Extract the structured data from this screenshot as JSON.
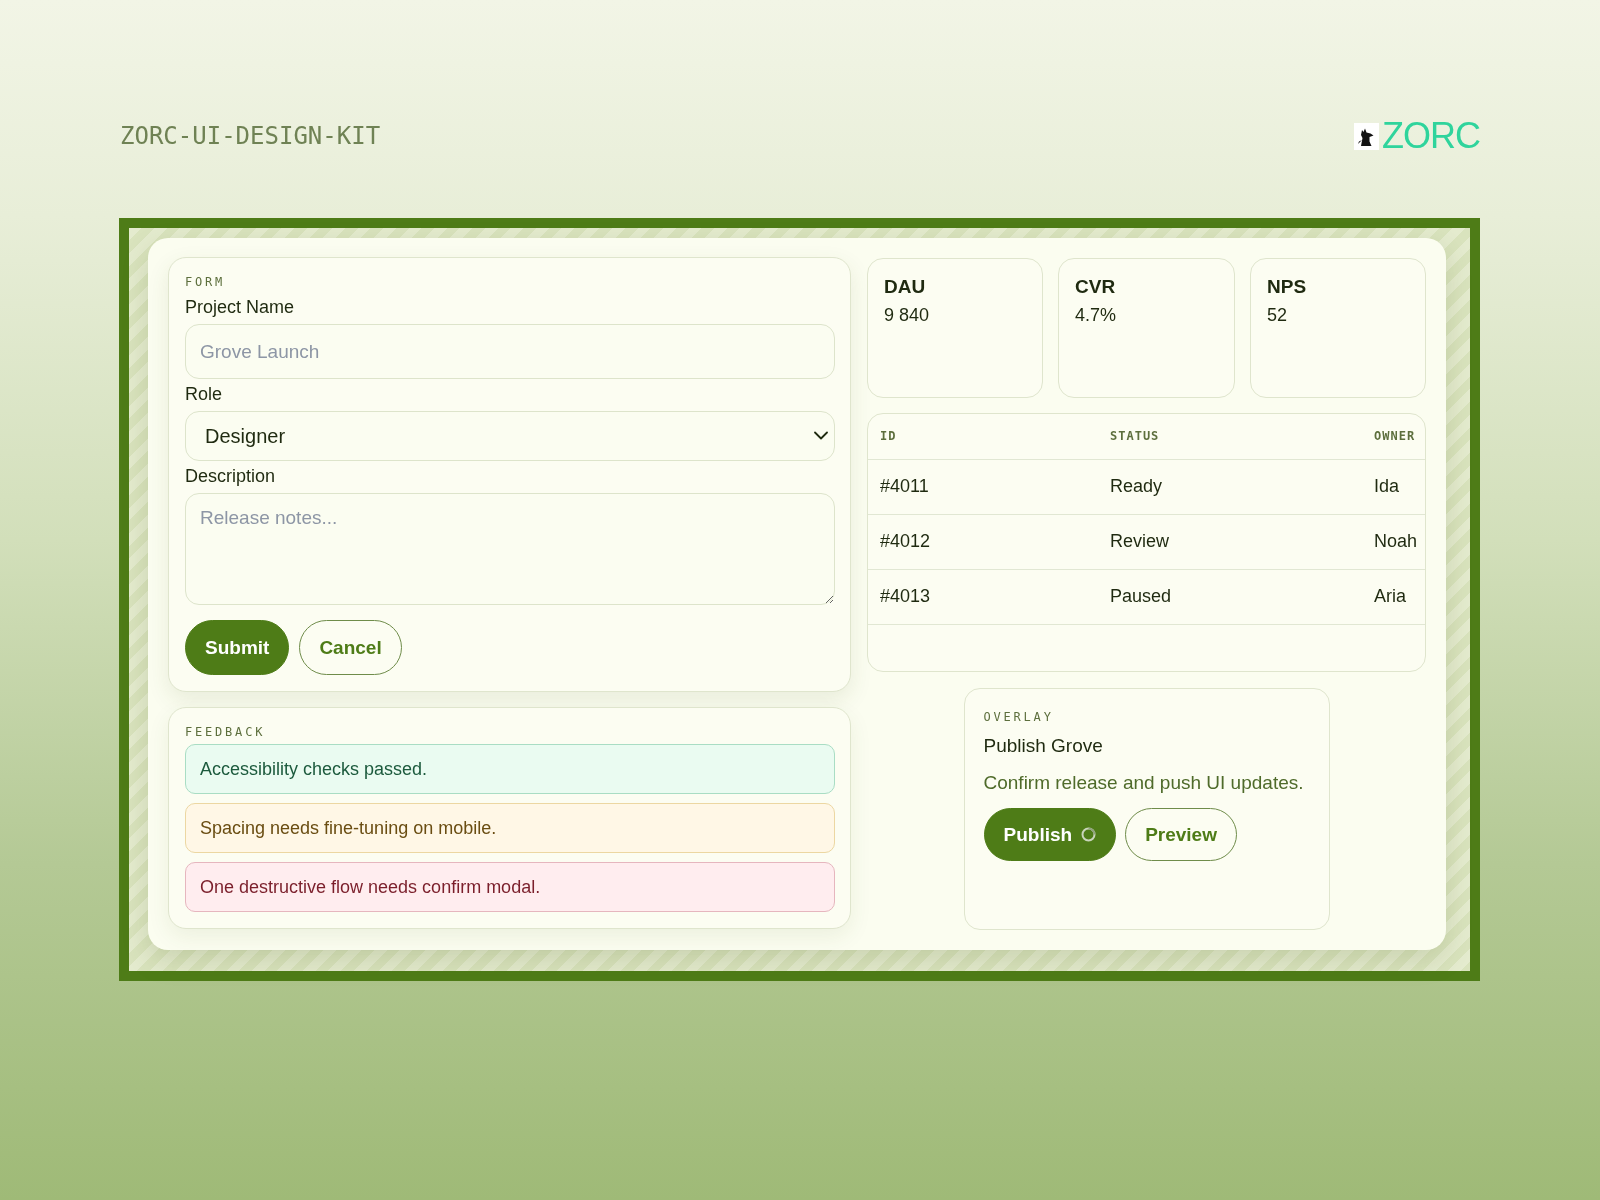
{
  "header": {
    "title": "ZORC-UI-DESIGN-KIT",
    "logo": "ZORC"
  },
  "form": {
    "section_label": "FORM",
    "fields": [
      {
        "kind": "text",
        "label": "Project Name",
        "placeholder": "Grove Launch"
      },
      {
        "kind": "select",
        "label": "Role",
        "value": "Designer"
      },
      {
        "kind": "textarea",
        "label": "Description",
        "placeholder": "Release notes..."
      }
    ],
    "buttons": [
      {
        "label": "Submit",
        "kind": "primary"
      },
      {
        "label": "Cancel",
        "kind": "secondary"
      }
    ]
  },
  "feedback": {
    "section_label": "FEEDBACK",
    "alerts": [
      {
        "kind": "success",
        "text": "Accessibility checks passed."
      },
      {
        "kind": "warning",
        "text": "Spacing needs fine-tuning on mobile."
      },
      {
        "kind": "danger",
        "text": "One destructive flow needs confirm modal."
      }
    ]
  },
  "stats": [
    {
      "label": "DAU",
      "value": "9 840"
    },
    {
      "label": "CVR",
      "value": "4.7%"
    },
    {
      "label": "NPS",
      "value": "52"
    }
  ],
  "table": {
    "columns": [
      "ID",
      "STATUS",
      "OWNER"
    ],
    "rows": [
      [
        "#4011",
        "Ready",
        "Ida"
      ],
      [
        "#4012",
        "Review",
        "Noah"
      ],
      [
        "#4013",
        "Paused",
        "Aria"
      ]
    ]
  },
  "overlay": {
    "section_label": "OVERLAY",
    "title": "Publish Grove",
    "message": "Confirm release and push UI updates.",
    "buttons": [
      {
        "label": "Publish",
        "kind": "primary",
        "loading": true
      },
      {
        "label": "Preview",
        "kind": "secondary",
        "loading": false
      }
    ]
  }
}
